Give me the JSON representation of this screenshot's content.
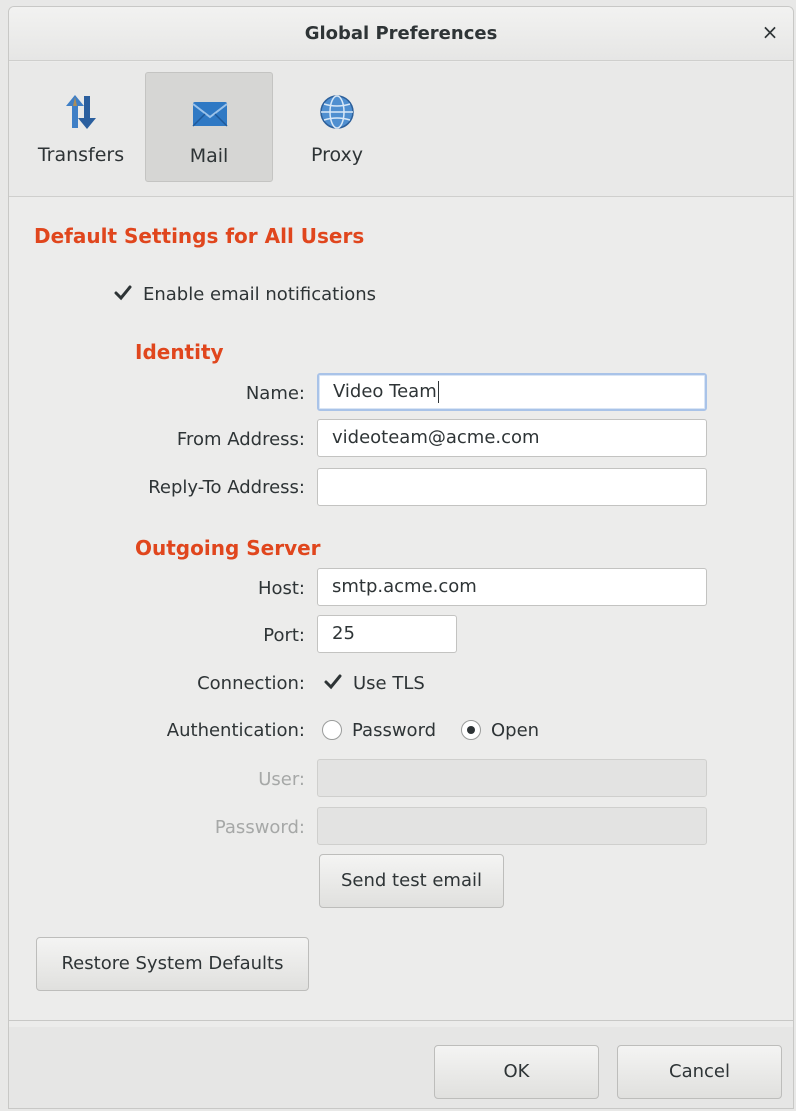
{
  "window": {
    "title": "Global Preferences",
    "close_glyph": "×"
  },
  "tabs": [
    {
      "label": "Transfers",
      "icon": "transfers-icon",
      "active": false
    },
    {
      "label": "Mail",
      "icon": "mail-icon",
      "active": true
    },
    {
      "label": "Proxy",
      "icon": "proxy-globe-icon",
      "active": false
    }
  ],
  "section_title": "Default Settings for All Users",
  "enable_notifications": {
    "label": "Enable email notifications",
    "checked": true
  },
  "identity": {
    "title": "Identity",
    "name_label": "Name:",
    "name_value": "Video Team",
    "from_label": "From Address:",
    "from_value": "videoteam@acme.com",
    "reply_label": "Reply-To Address:",
    "reply_value": ""
  },
  "server": {
    "title": "Outgoing Server",
    "host_label": "Host:",
    "host_value": "smtp.acme.com",
    "port_label": "Port:",
    "port_value": "25",
    "connection_label": "Connection:",
    "tls_label": "Use TLS",
    "tls_checked": true,
    "auth_label": "Authentication:",
    "auth_password_label": "Password",
    "auth_open_label": "Open",
    "auth_selected": "Open",
    "user_label": "User:",
    "user_value": "",
    "password_label": "Password:",
    "password_value": "",
    "send_test_label": "Send test email"
  },
  "restore_label": "Restore System Defaults",
  "footer": {
    "ok_label": "OK",
    "cancel_label": "Cancel"
  },
  "colors": {
    "section_heading": "#e0461d",
    "focus_ring": "#a9c3e8",
    "mail_icon": "#2f79c4"
  }
}
